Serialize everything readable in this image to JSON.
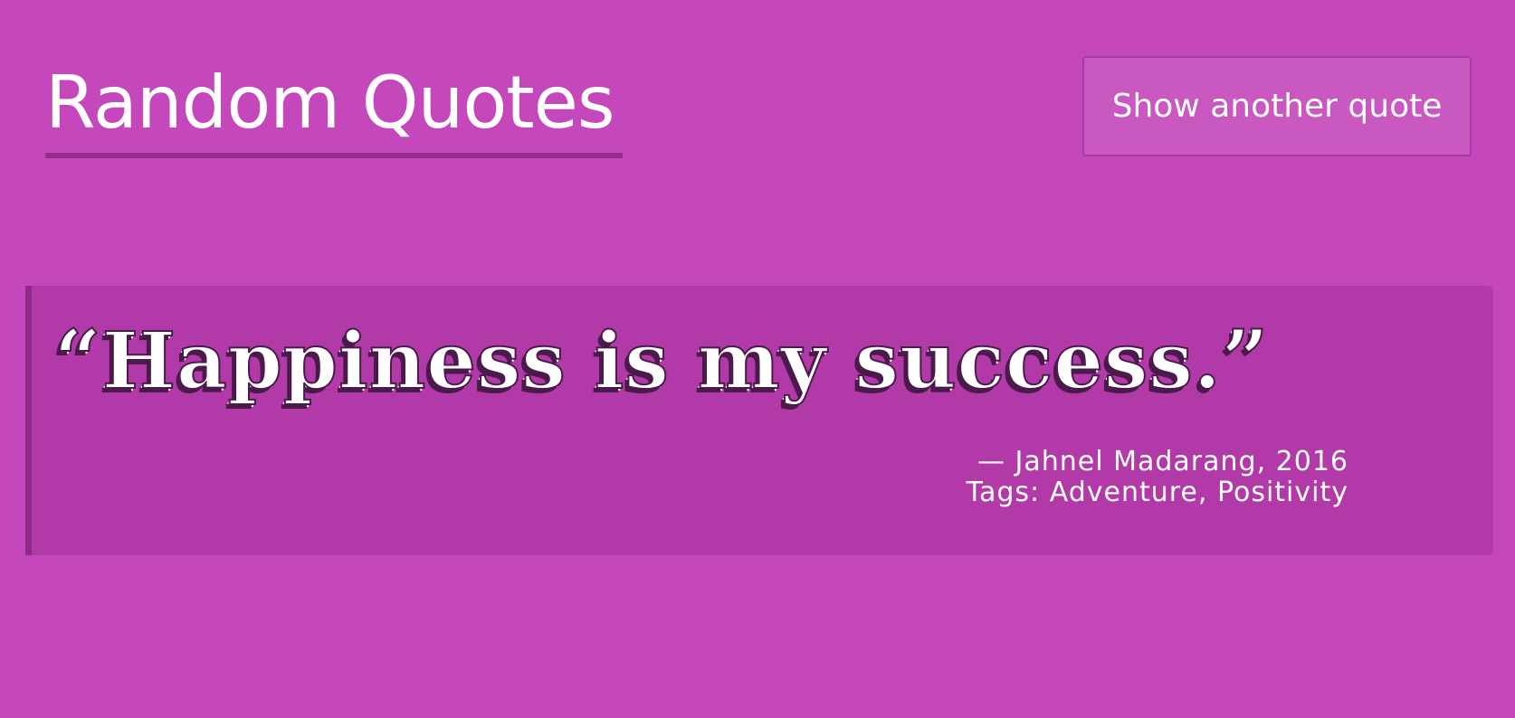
{
  "colors": {
    "background": "#c447bb",
    "card": "#b13aa8",
    "card_bar": "#8e2a88",
    "button": "#c958c0",
    "underline": "#932e8c"
  },
  "header": {
    "title": "Random Quotes",
    "button_label": "Show another quote"
  },
  "quote": {
    "open_mark": "“",
    "text": "Happiness is my success.",
    "close_mark": "”",
    "attribution": "— Jahnel Madarang, 2016",
    "tags_line": "Tags: Adventure, Positivity"
  }
}
